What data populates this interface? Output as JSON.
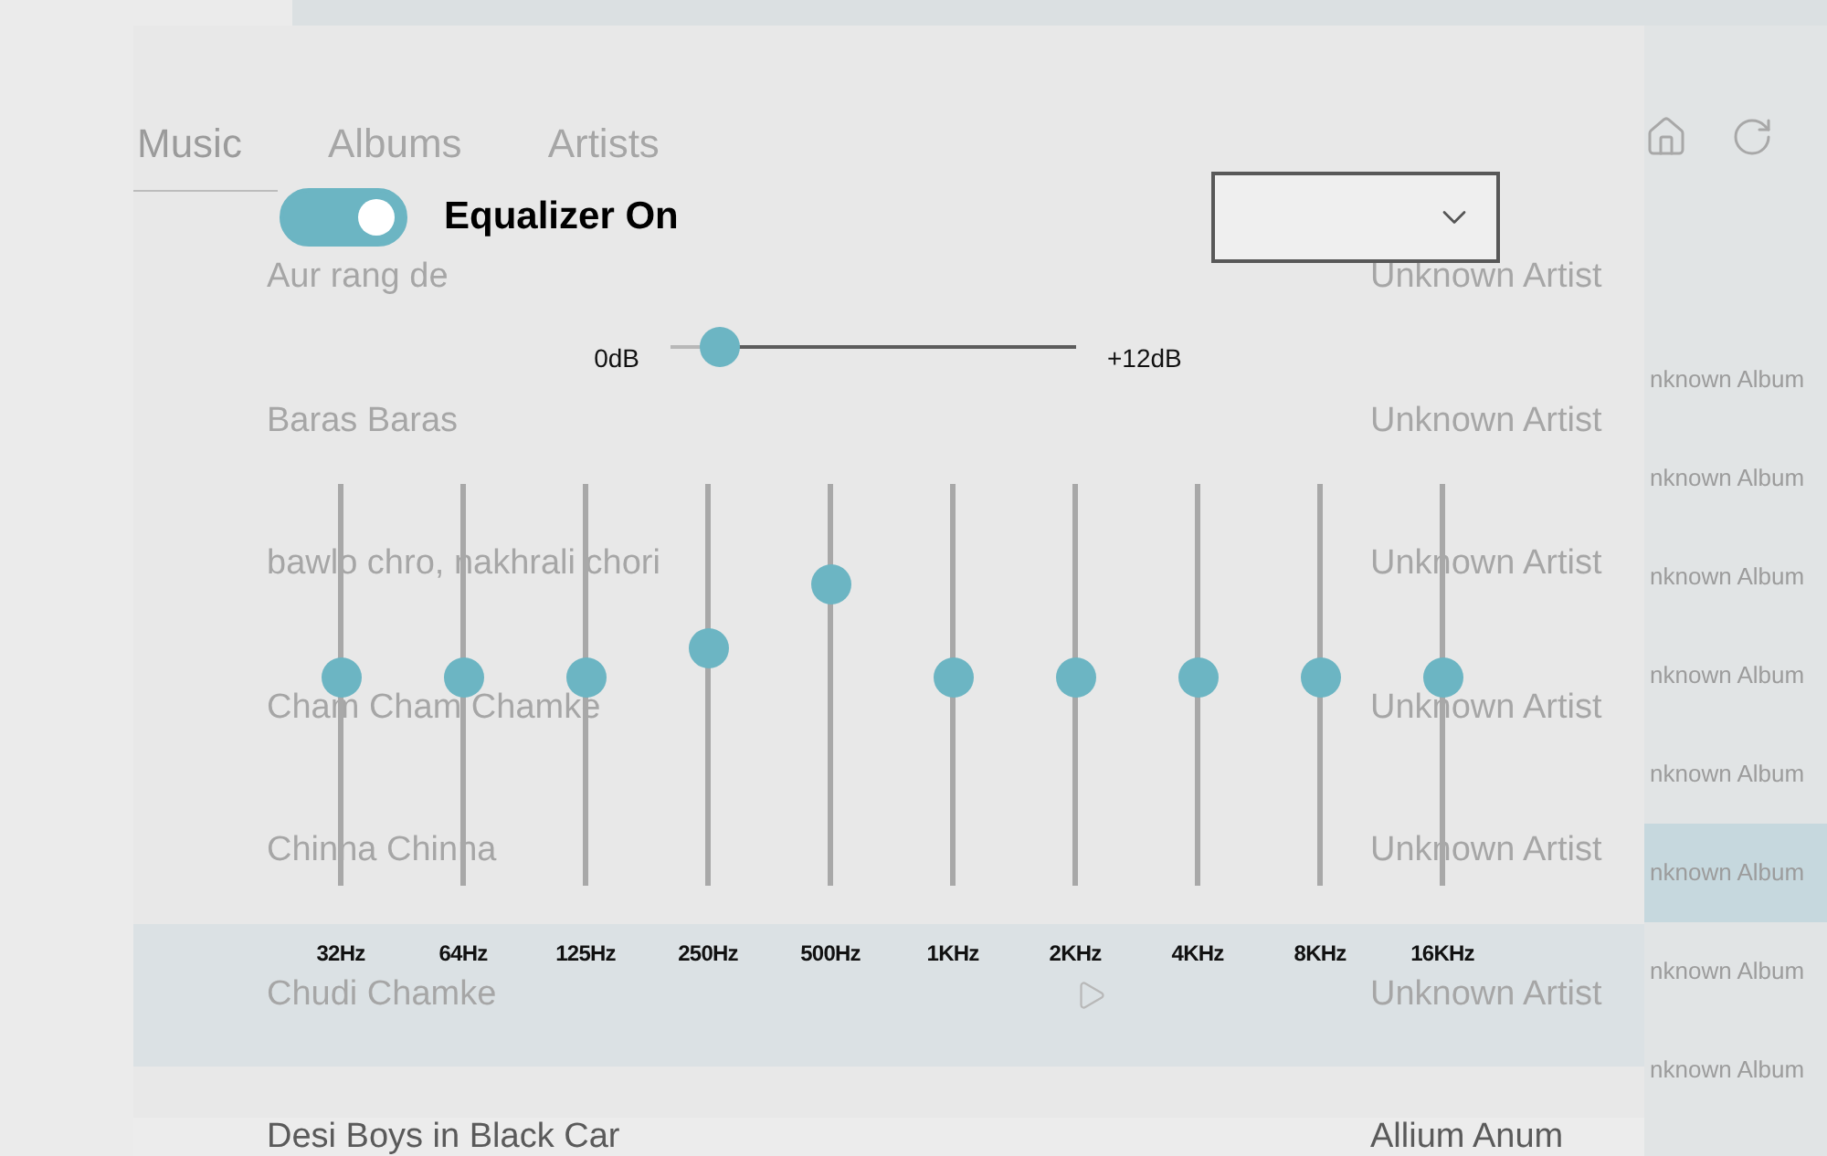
{
  "background": {
    "tabs": [
      {
        "label": "Music",
        "selected": true
      },
      {
        "label": "Albums",
        "selected": false
      },
      {
        "label": "Artists",
        "selected": false
      }
    ],
    "songs": [
      {
        "title": "Aur rang de",
        "artist": "Unknown Artist",
        "hovered": false
      },
      {
        "title": "Baras Baras",
        "artist": "Unknown Artist",
        "hovered": false
      },
      {
        "title": "bawlo chro, nakhrali chori",
        "artist": "Unknown Artist",
        "hovered": false
      },
      {
        "title": "Cham Cham Chamke",
        "artist": "Unknown Artist",
        "hovered": false
      },
      {
        "title": "Chinna Chinna",
        "artist": "Unknown Artist",
        "hovered": false
      },
      {
        "title": "Chudi Chamke",
        "artist": "Unknown Artist",
        "hovered": true
      },
      {
        "title": "Desi Boys in Black Car",
        "artist": "Allium Anum",
        "hovered": false
      }
    ],
    "albums": [
      {
        "title": "nknown Album",
        "selected": false
      },
      {
        "title": "nknown Album",
        "selected": false
      },
      {
        "title": "nknown Album",
        "selected": false
      },
      {
        "title": "nknown Album",
        "selected": false
      },
      {
        "title": "nknown Album",
        "selected": false
      },
      {
        "title": "nknown Album",
        "selected": true
      },
      {
        "title": "nknown Album",
        "selected": false
      },
      {
        "title": "nknown Album",
        "selected": false
      }
    ]
  },
  "equalizer": {
    "enabled": true,
    "label": "Equalizer On",
    "gain": {
      "min_label": "0dB",
      "max_label": "+12dB",
      "level": 0.12
    },
    "bands": [
      {
        "label": "32Hz",
        "level": 0.52
      },
      {
        "label": "64Hz",
        "level": 0.52
      },
      {
        "label": "125Hz",
        "level": 0.52
      },
      {
        "label": "250Hz",
        "level": 0.59
      },
      {
        "label": "500Hz",
        "level": 0.75
      },
      {
        "label": "1KHz",
        "level": 0.52
      },
      {
        "label": "2KHz",
        "level": 0.52
      },
      {
        "label": "4KHz",
        "level": 0.52
      },
      {
        "label": "8KHz",
        "level": 0.52
      },
      {
        "label": "16KHz",
        "level": 0.52
      }
    ]
  }
}
